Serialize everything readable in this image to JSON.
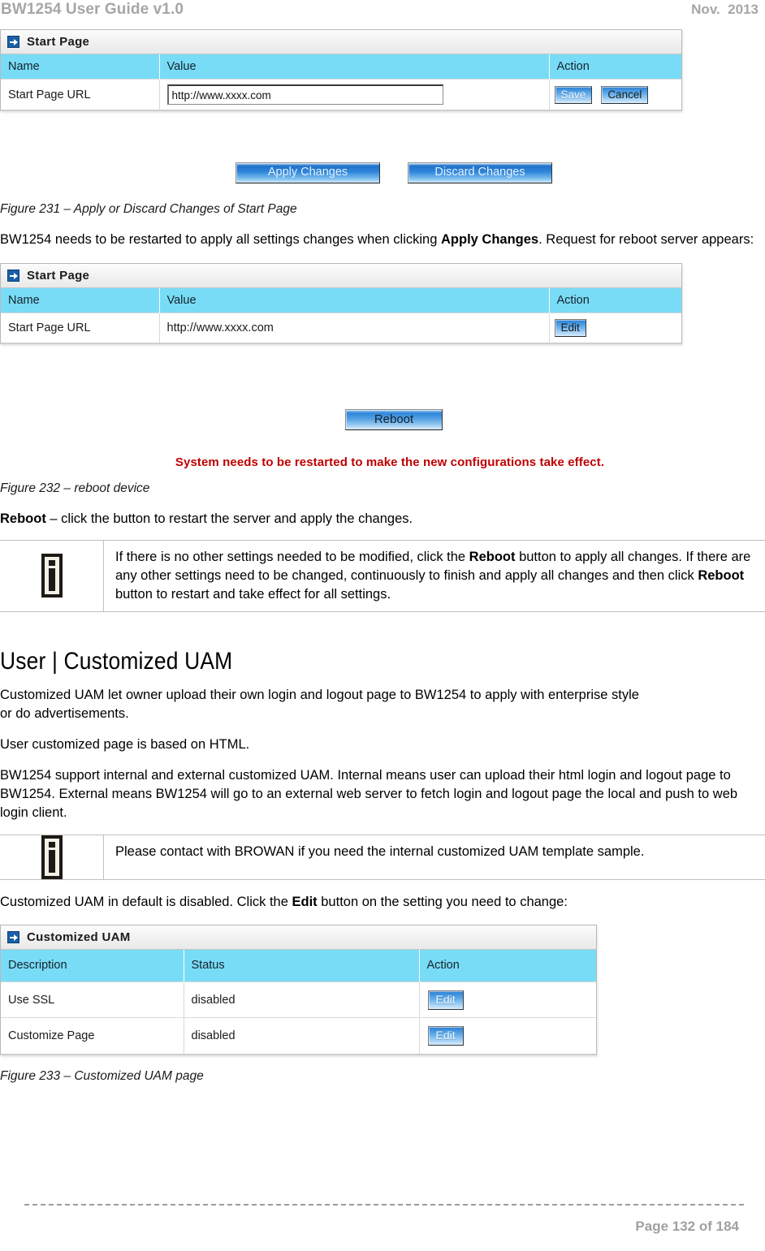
{
  "header": {
    "doc_title": "BW1254 User Guide v1.0",
    "date": "Nov.  2013"
  },
  "panel_start_page_edit": {
    "title": "Start Page",
    "title_icon": "arrow-right-box-icon",
    "columns": [
      "Name",
      "Value",
      "Action"
    ],
    "row": {
      "name": "Start Page URL",
      "value": "http://www.xxxx.com",
      "actions": [
        "Save",
        "Cancel"
      ]
    }
  },
  "apply_discard": {
    "apply_label": "Apply Changes",
    "discard_label": "Discard Changes"
  },
  "figure_231": "Figure 231 – Apply or Discard Changes of Start Page",
  "para_restart": {
    "part1": "BW1254 needs to be restarted to apply all settings changes when clicking ",
    "bold1": "Apply Changes",
    "part2": ". Request for reboot server appears:"
  },
  "panel_start_page_view": {
    "title": "Start Page",
    "title_icon": "arrow-right-box-icon",
    "columns": [
      "Name",
      "Value",
      "Action"
    ],
    "row": {
      "name": "Start Page URL",
      "value": "http://www.xxxx.com",
      "action": "Edit"
    }
  },
  "reboot_panel": {
    "button_label": "Reboot",
    "warning": "System needs to be restarted to make the new configurations take effect."
  },
  "figure_232": "Figure 232 – reboot device",
  "para_reboot": {
    "bold1": "Reboot",
    "part2": " – click the button to restart the server and apply the changes."
  },
  "note_reboot": {
    "icon": "info-icon",
    "part1": "If there is no other settings needed to be modified, click the ",
    "bold1": "Reboot",
    "part2": " button to apply all changes. If there are any other settings need to be changed, continuously to finish and apply all changes and then click ",
    "bold2": "Reboot",
    "part3": " button to restart and take effect  for all settings."
  },
  "section_heading": "User | Customized UAM",
  "para_uam_1": "Customized UAM let owner upload their own login and logout page to BW1254 to apply with enterprise style or do advertisements.",
  "para_uam_2": "User customized page is based on HTML.",
  "para_uam_3": "BW1254 support internal and external customized UAM. Internal means user can upload their html login and logout page to BW1254. External means BW1254 will go to an external web server to fetch login and logout page the local and push to web login client.",
  "note_browan": {
    "icon": "info-icon",
    "text": "Please contact with BROWAN if you need the internal customized UAM template sample."
  },
  "para_uam_4": {
    "part1": "Customized UAM in default is disabled.  Click the ",
    "bold1": "Edit",
    "part2": " button on the setting you need to change:"
  },
  "panel_customized_uam": {
    "title": "Customized UAM",
    "title_icon": "arrow-right-box-icon",
    "columns": [
      "Description",
      "Status",
      "Action"
    ],
    "rows": [
      {
        "description": "Use SSL",
        "status": "disabled",
        "action": "Edit"
      },
      {
        "description": "Customize Page",
        "status": "disabled",
        "action": "Edit"
      }
    ]
  },
  "figure_233": "Figure 233 – Customized UAM page",
  "footer": {
    "page_label": "Page 132 of 184"
  },
  "colors": {
    "table_header_blue": "#79dcf7",
    "button_blue": "#2f86da",
    "warning_red": "#c00000",
    "header_gray": "#a6a6a6"
  }
}
